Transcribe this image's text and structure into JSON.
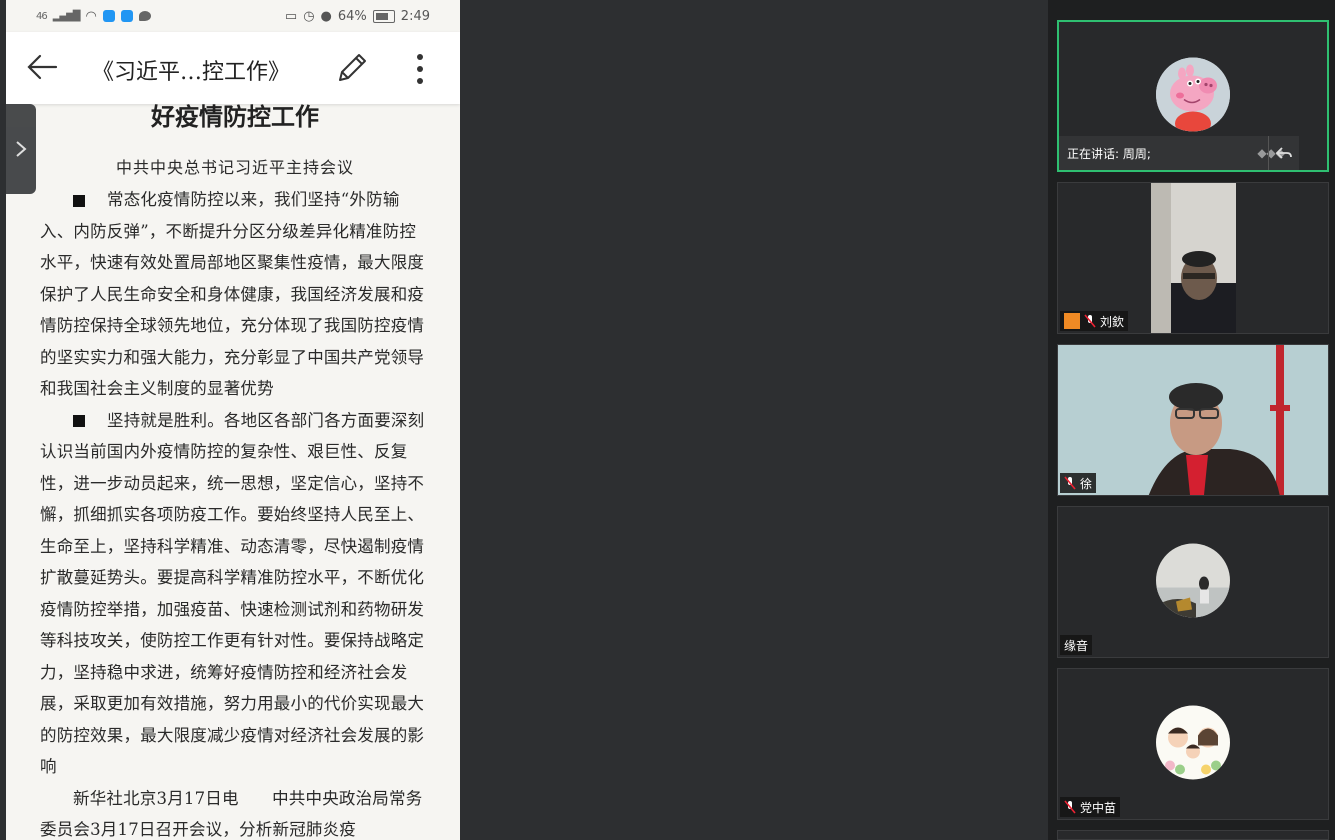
{
  "status_bar": {
    "signal": "46",
    "battery": "64%",
    "time": "2:49"
  },
  "app_bar": {
    "title": "《习近平…控工作》"
  },
  "document": {
    "heading": "好疫情防控工作",
    "subheading": "中共中央总书记习近平主持会议",
    "paragraphs": [
      "常态化疫情防控以来，我们坚持“外防输入、内防反弹”，不断提升分区分级差异化精准防控水平，快速有效处置局部地区聚集性疫情，最大限度保护了人民生命安全和身体健康，我国经济发展和疫情防控保持全球领先地位，充分体现了我国防控疫情的坚实实力和强大能力，充分彰显了中国共产党领导和我国社会主义制度的显著优势",
      "坚持就是胜利。各地区各部门各方面要深刻认识当前国内外疫情防控的复杂性、艰巨性、反复性，进一步动员起来，统一思想，坚定信心，坚持不懈，抓细抓实各项防疫工作。要始终坚持人民至上、生命至上，坚持科学精准、动态清零，尽快遏制疫情扩散蔓延势头。要提高科学精准防控水平，不断优化疫情防控举措，加强疫苗、快速检测试剂和药物研发等科技攻关，使防控工作更有针对性。要保持战略定力，坚持稳中求进，统筹好疫情防控和经济社会发展，采取更加有效措施，努力用最小的代价实现最大的防控效果，最大限度减少疫情对经济社会发展的影响",
      "新华社北京3月17日电　　中共中央政治局常务委员会3月17日召开会议，分析新冠肺炎疫"
    ]
  },
  "participants": [
    {
      "name": "",
      "speaking_label": "正在讲话: 周周;",
      "avatar": "peppa-pig-avatar",
      "active": true
    },
    {
      "name": "刘欽",
      "avatar": "camera-video",
      "muted": true
    },
    {
      "name": "徐",
      "avatar": "camera-video",
      "muted": true
    },
    {
      "name": "缘音",
      "avatar": "seaside-photo-avatar",
      "muted": false
    },
    {
      "name": "党中苗",
      "avatar": "cartoon-family-avatar",
      "muted": true
    }
  ],
  "colors": {
    "active_border": "#2fbf71",
    "panel_bg": "#1e1f20",
    "tile_bg": "#28292b"
  }
}
